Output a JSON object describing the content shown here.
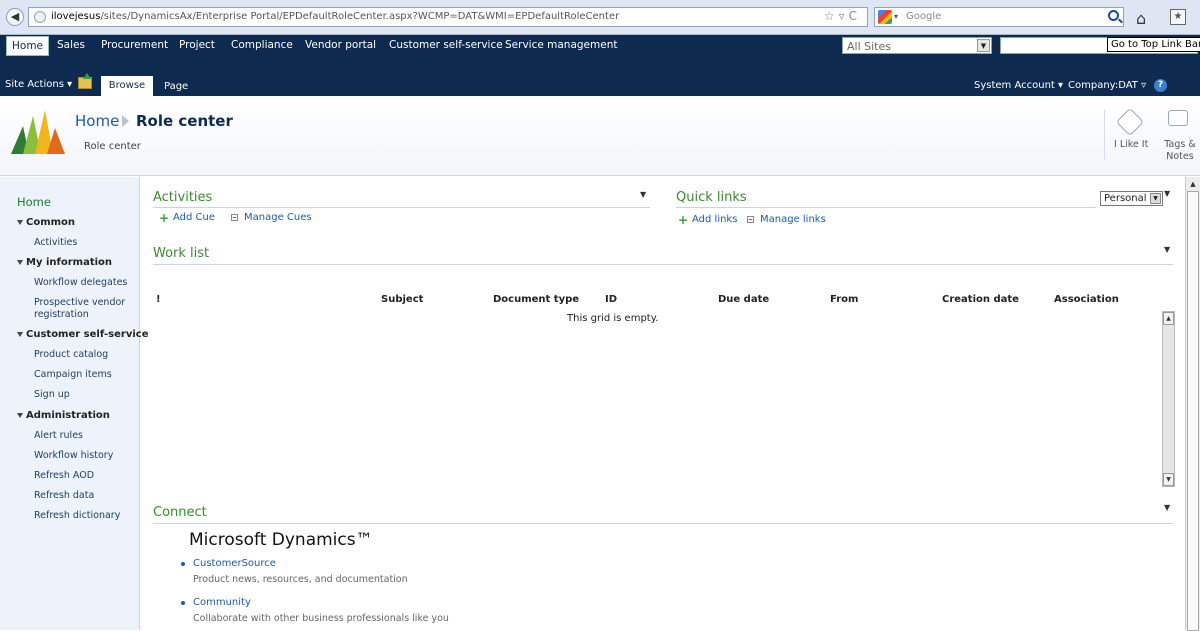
{
  "browser": {
    "url_prefix": "ilovejesus",
    "url_rest": "/sites/DynamicsAx/Enterprise Portal/EPDefaultRoleCenter.aspx?WCMP=DAT&WMI=EPDefaultRoleCenter",
    "search_placeholder": "Google"
  },
  "topnav": {
    "items": [
      "Home",
      "Sales",
      "Procurement",
      "Project",
      "Compliance",
      "Vendor portal",
      "Customer self-service",
      "Service management"
    ],
    "search_scope": "All Sites",
    "goto_link": "Go to Top Link Bar"
  },
  "ribbon": {
    "site_actions": "Site Actions",
    "tab_browse": "Browse",
    "tab_page": "Page",
    "account": "System Account",
    "company": "Company:DAT",
    "help": "?"
  },
  "title": {
    "crumb_home": "Home",
    "crumb_current": "Role center",
    "subtitle": "Role center",
    "like_label": "I Like It",
    "tags_label": "Tags & Notes"
  },
  "leftnav": {
    "home": "Home",
    "groups": [
      {
        "title": "Common",
        "items": [
          "Activities"
        ]
      },
      {
        "title": "My information",
        "items": [
          "Workflow delegates",
          "Prospective vendor registration"
        ]
      },
      {
        "title": "Customer self-service",
        "items": [
          "Product catalog",
          "Campaign items",
          "Sign up"
        ]
      },
      {
        "title": "Administration",
        "items": [
          "Alert rules",
          "Workflow history",
          "Refresh AOD",
          "Refresh data",
          "Refresh dictionary"
        ]
      }
    ]
  },
  "activities": {
    "title": "Activities",
    "add_cue": "Add Cue",
    "manage_cues": "Manage Cues"
  },
  "quicklinks": {
    "title": "Quick links",
    "add_links": "Add links",
    "manage_links": "Manage links",
    "view_selected": "Personal"
  },
  "worklist": {
    "title": "Work list",
    "columns": [
      "!",
      "Subject",
      "Document type",
      "ID",
      "Due date",
      "From",
      "Creation date",
      "Association"
    ],
    "empty_text": "This grid is empty."
  },
  "connect": {
    "title": "Connect",
    "brand": "Microsoft Dynamics™",
    "links": [
      {
        "label": "CustomerSource",
        "desc": "Product news, resources, and documentation"
      },
      {
        "label": "Community",
        "desc": "Collaborate with other business professionals like you"
      }
    ]
  },
  "colors": {
    "nav_bg": "#0f2a4f",
    "section_title": "#3a8b2e",
    "link": "#1f5aa6"
  }
}
